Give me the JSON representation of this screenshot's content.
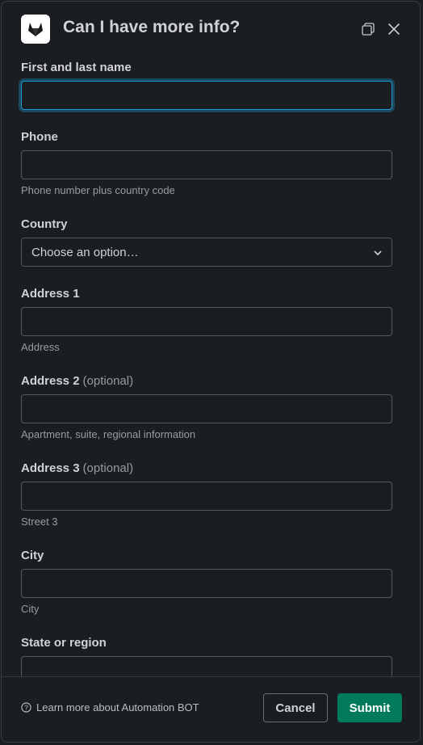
{
  "header": {
    "title": "Can I have more info?",
    "app_icon": "gitlab-fox-icon",
    "popout_icon": "popout-window-icon",
    "close_icon": "close-icon"
  },
  "fields": {
    "name": {
      "label": "First and last name",
      "value": ""
    },
    "phone": {
      "label": "Phone",
      "value": "",
      "hint": "Phone number plus country code"
    },
    "country": {
      "label": "Country",
      "selected": "Choose an option…"
    },
    "address1": {
      "label": "Address 1",
      "value": "",
      "hint": "Address"
    },
    "address2": {
      "label": "Address 2",
      "optional": "(optional)",
      "value": "",
      "hint": "Apartment, suite, regional information"
    },
    "address3": {
      "label": "Address 3",
      "optional": "(optional)",
      "value": "",
      "hint": "Street 3"
    },
    "city": {
      "label": "City",
      "value": "",
      "hint": "City"
    },
    "state": {
      "label": "State or region",
      "value": ""
    }
  },
  "footer": {
    "learn_more": "Learn more about Automation BOT",
    "cancel_label": "Cancel",
    "submit_label": "Submit"
  },
  "colors": {
    "background": "#1a1d21",
    "focus_border": "#1d9bd1",
    "submit": "#007a5a"
  }
}
